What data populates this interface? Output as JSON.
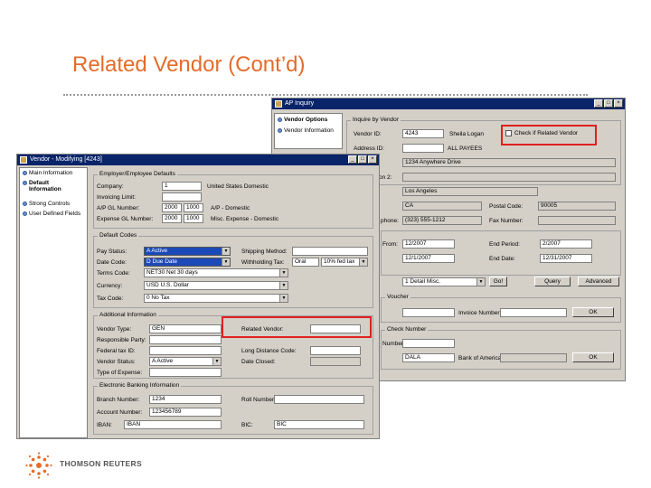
{
  "slide": {
    "title": "Related Vendor (Cont’d)",
    "brand": "THOMSON REUTERS"
  },
  "ap_window": {
    "title": "AP Inquiry",
    "nav": [
      "Vendor Options",
      "Vendor Information"
    ],
    "group_inquire": "Inquire by Vendor",
    "vendor_id_label": "Vendor ID:",
    "vendor_id": "4243",
    "vendor_name": "Sheila Logan",
    "check_label": "Check if Related Vendor",
    "address_id_label": "Address ID:",
    "address_id_value": "",
    "all_payees": "ALL PAYEES",
    "address_line": "1234 Anywhere Drive",
    "address2_label": "on 2:",
    "city": "Los Angeles",
    "state": "CA",
    "zip_label": "Postal Code:",
    "zip": "90005",
    "phone_label": "phone:",
    "phone": "(323) 555-1212",
    "fax_label": "Fax Number:",
    "period_from_label": "From:",
    "period_from": "12/2007",
    "end_period_label": "End Period:",
    "end_period": "2/2007",
    "end_date_label": "End Date:",
    "end_date": "12/31/2007",
    "from_date": "12/1/2007",
    "option_value": "1 Detail Misc.",
    "go_label": "Go!",
    "query_label": "Query",
    "advanced_label": "Advanced",
    "voucher_group": "Voucher",
    "invoice_label": "Invoice Number:",
    "ok_label": "OK",
    "check_group": "Check Number",
    "number_label": "Number:",
    "bank_value": "DALA",
    "bank_label": "Bank of America",
    "ok2_label": "OK"
  },
  "vm_window": {
    "title": "Vendor - Modifying [4243]",
    "nav": [
      "Main Information",
      "Default Information",
      "Strong Controls",
      "User Defined Fields"
    ],
    "employer_group": "Employer/Employee Defaults",
    "company_label": "Company:",
    "company": "1",
    "company_desc": "United States Domestic",
    "invoicing_limit_label": "Invoicing Limit:",
    "ap_gl_label": "A/P GL Number:",
    "ap_gl_a": "2000",
    "ap_gl_b": "1000",
    "ap_gl_desc": "A/P - Domestic",
    "exp_gl_label": "Expense GL Number:",
    "exp_gl_a": "2000",
    "exp_gl_b": "1000",
    "exp_gl_desc": "Misc. Expense - Domestic",
    "default_group": "Default Codes",
    "pay_status_label": "Pay Status:",
    "pay_status": "A  Active",
    "date_code_label": "Date Code:",
    "date_code": "D  Due Date",
    "terms_label": "Terms Code:",
    "terms": "NET30  Net 30 days",
    "currency_label": "Currency:",
    "currency": "USD  U.S. Dollar",
    "tax_label": "Tax Code:",
    "tax": "0  No Tax",
    "shipping_label": "Shipping Method:",
    "withholding_label": "Withholding Tax:",
    "withholding_a": "Oral",
    "withholding_b": "10% fed tax",
    "additional_group": "Additional Information",
    "vendor_type_label": "Vendor Type:",
    "vendor_type": "GEN",
    "related_vendor_label": "Related Vendor:",
    "responsible_label": "Responsible Party:",
    "federal_id_label": "Federal tax ID:",
    "long_code_label": "Long Distance Code:",
    "vendor_status_label": "Vendor Status:",
    "vendor_status": "A  Active",
    "date_closed_label": "Date Closed:",
    "type_exp_label": "Type of Expense:",
    "banking_group": "Electronic Banking Information",
    "branch_label": "Branch Number:",
    "branch": "1234",
    "roll_label": "Roll Number:",
    "account_label": "Account Number:",
    "account": "123456789",
    "iban_label": "IBAN:",
    "iban": "IBAN",
    "bic_label": "BIC:",
    "bic": "BIC"
  }
}
